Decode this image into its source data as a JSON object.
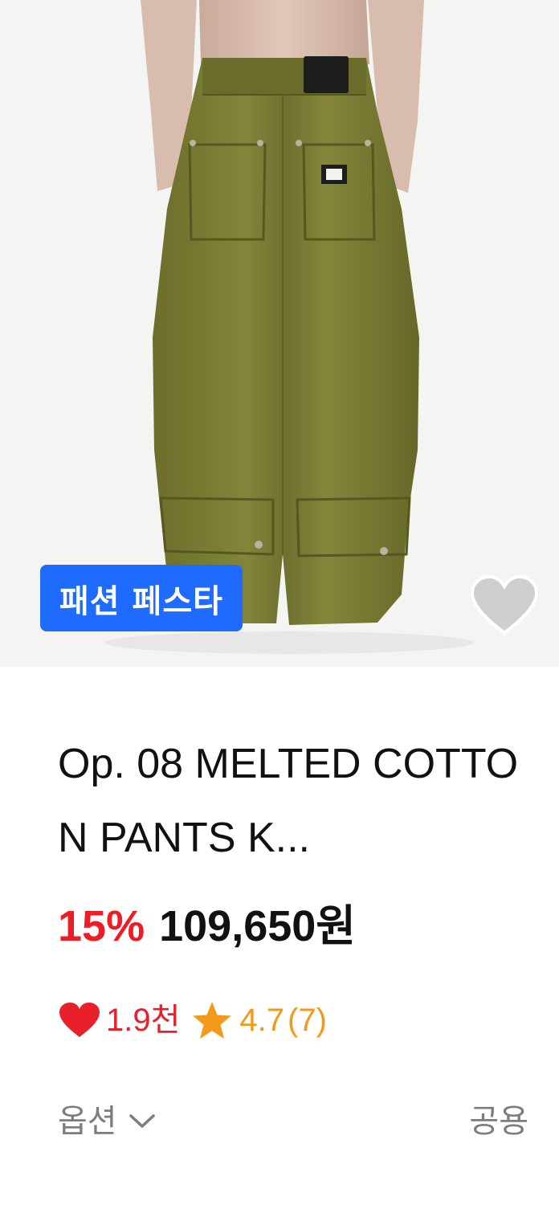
{
  "product": {
    "badge": "패션 페스타",
    "title": "Op. 08 MELTED COTTON PANTS K...",
    "discount": "15%",
    "price": "109,650원",
    "likes": "1.9천",
    "rating": "4.7",
    "review_count": "(7)",
    "option_label": "옵션",
    "gender": "공용",
    "image_alt": "olive green wide cotton pants, back view"
  },
  "colors": {
    "badge_bg": "#1f6bff",
    "discount": "#ee1c25",
    "heart": "#e8202a",
    "star": "#f39a1b",
    "pants": "#7a7c33"
  },
  "icons": {
    "wish": "heart-outline-icon",
    "likes": "heart-icon",
    "rating": "star-icon",
    "option": "chevron-down-icon"
  }
}
